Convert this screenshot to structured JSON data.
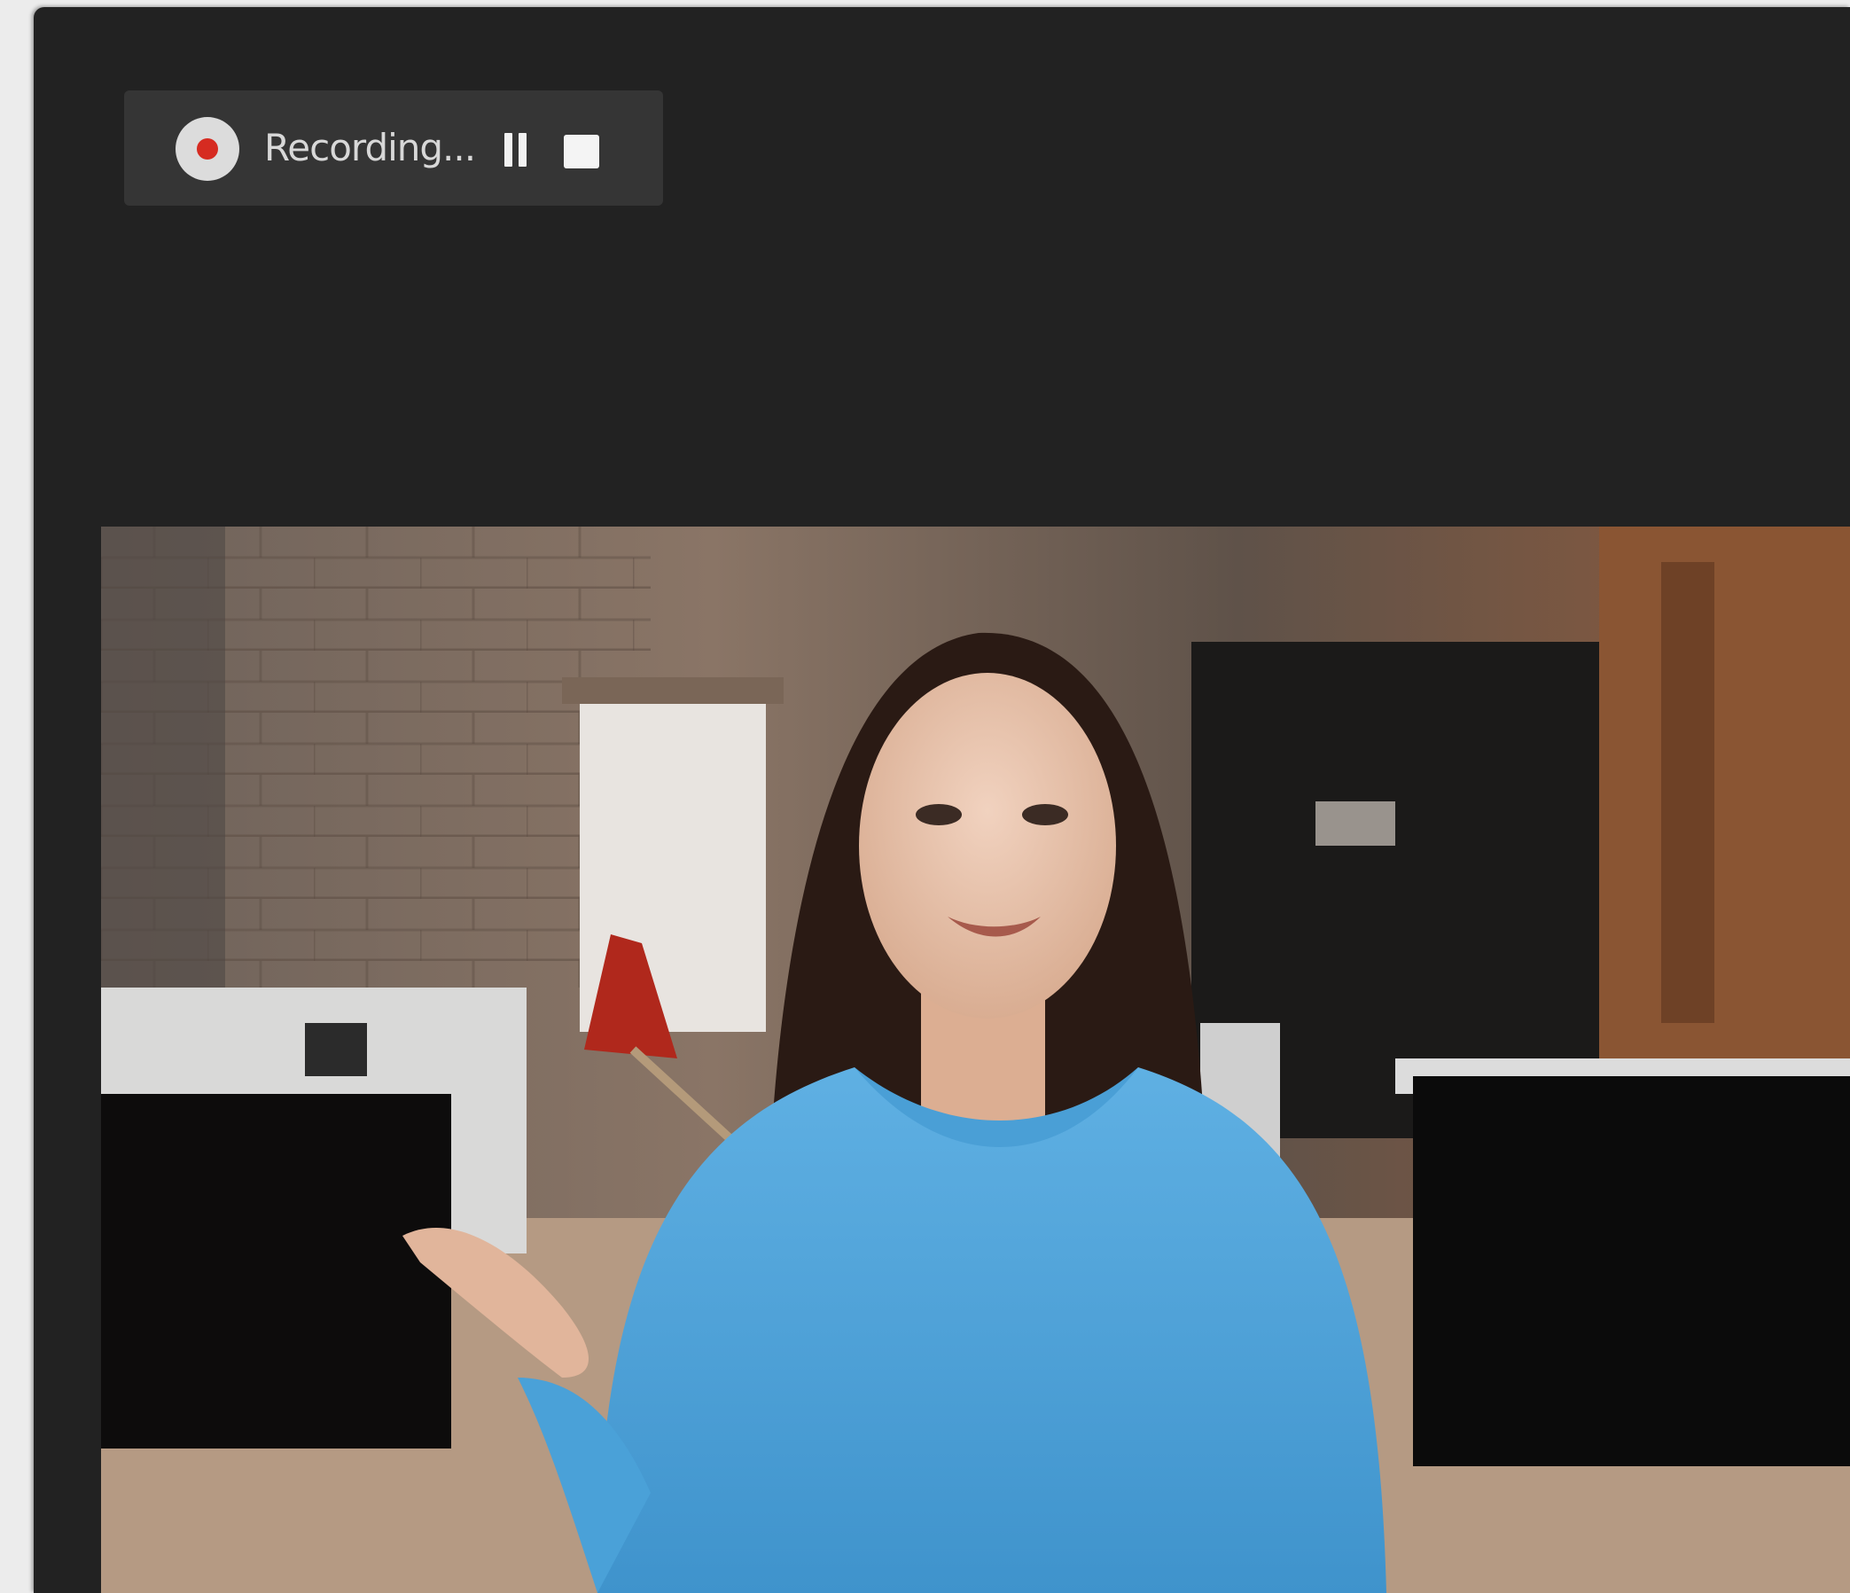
{
  "recorder": {
    "status_label": "Recording...",
    "indicator_color": "#d62b21",
    "pause_icon": "pause-icon",
    "stop_icon": "stop-icon"
  },
  "colors": {
    "window_bg": "#222222",
    "toolbar_bg": "#353535",
    "page_bg": "#ececec"
  }
}
